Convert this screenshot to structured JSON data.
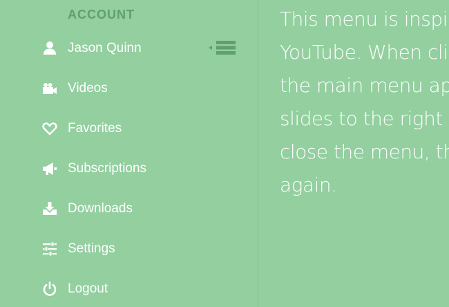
{
  "sidebar": {
    "section_title": "ACCOUNT",
    "items": [
      {
        "label": "Jason Quinn",
        "icon": "user-icon"
      },
      {
        "label": "Videos",
        "icon": "video-camera-icon"
      },
      {
        "label": "Favorites",
        "icon": "heart-icon"
      },
      {
        "label": "Subscriptions",
        "icon": "megaphone-icon"
      },
      {
        "label": "Downloads",
        "icon": "download-icon"
      },
      {
        "label": "Settings",
        "icon": "sliders-icon"
      },
      {
        "label": "Logout",
        "icon": "power-icon"
      }
    ],
    "toggle_icon": "menu-collapse-icon"
  },
  "main": {
    "lines": [
      "This menu is inspired by",
      "YouTube. When clicking",
      "the main menu appears and",
      "slides to the right side. To",
      "close the menu, the user clicks",
      "again."
    ]
  },
  "colors": {
    "background": "#93cf9f",
    "section_title": "#5fa06f",
    "toggle": "#5fa06f",
    "text": "#ffffff"
  }
}
